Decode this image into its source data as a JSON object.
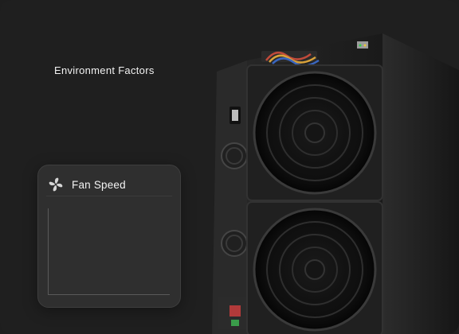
{
  "section": {
    "title": "Environment Factors"
  },
  "fan_widget": {
    "title": "Fan Speed",
    "icon": "fan-icon"
  },
  "colors": {
    "background": "#1f1f1f",
    "text": "#f2f2f2",
    "widget_bg": "#343434"
  }
}
